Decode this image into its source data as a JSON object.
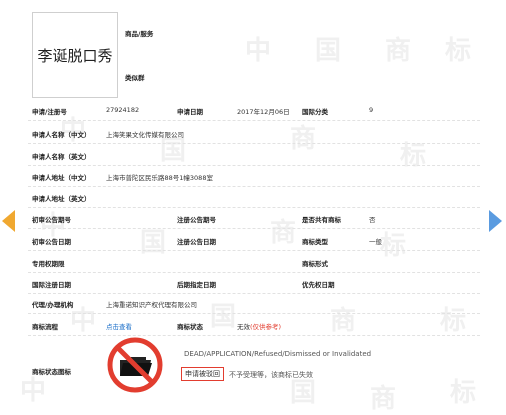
{
  "mark": {
    "name": "李诞脱口秀",
    "goods_label": "商品/服务",
    "class_group_label": "类似群"
  },
  "fields": {
    "reg_no_label": "申请/注册号",
    "reg_no": "27924182",
    "app_date_label": "申请日期",
    "app_date": "2017年12月06日",
    "intl_class_label": "国际分类",
    "intl_class": "9",
    "applicant_cn_label": "申请人名称（中文）",
    "applicant_cn": "上海笑果文化传媒有限公司",
    "applicant_en_label": "申请人名称（英文）",
    "address_cn_label": "申请人地址（中文）",
    "address_cn": "上海市普陀区民乐路88号1幢3088室",
    "address_en_label": "申请人地址（英文）",
    "prelim_no_label": "初审公告期号",
    "reg_notice_no_label": "注册公告期号",
    "shared_label": "是否共有商标",
    "shared": "否",
    "prelim_date_label": "初审公告日期",
    "reg_notice_date_label": "注册公告日期",
    "mark_type_label": "商标类型",
    "mark_type": "一般",
    "excl_period_label": "专用权期限",
    "mark_form_label": "商标形式",
    "intl_reg_date_label": "国际注册日期",
    "later_date_label": "后期指定日期",
    "priority_date_label": "优先权日期",
    "agent_label": "代理/办理机构",
    "agent": "上海重诺知识产权代理有限公司",
    "process_label": "商标流程",
    "process_link": "点击查看",
    "status_label": "商标状态",
    "status_value": "无效",
    "status_note": "(仅供参考)",
    "status_icon_label": "商标状态图标"
  },
  "status": {
    "english": "DEAD/APPLICATION/Refused/Dismissed or Invalidated",
    "stamp": "申请被驳回",
    "note": "不予受理等，该商标已失效"
  },
  "watermarks": [
    "中",
    "国",
    "商",
    "标",
    "中",
    "国",
    "商",
    "标",
    "中",
    "国",
    "商",
    "标",
    "中",
    "国",
    "商",
    "标",
    "中",
    "国",
    "商",
    "标"
  ],
  "colors": {
    "accent_link": "#1a6ec8",
    "status_red": "#e23d2f",
    "nav_left": "#f0a830",
    "nav_right": "#5a9be0"
  }
}
